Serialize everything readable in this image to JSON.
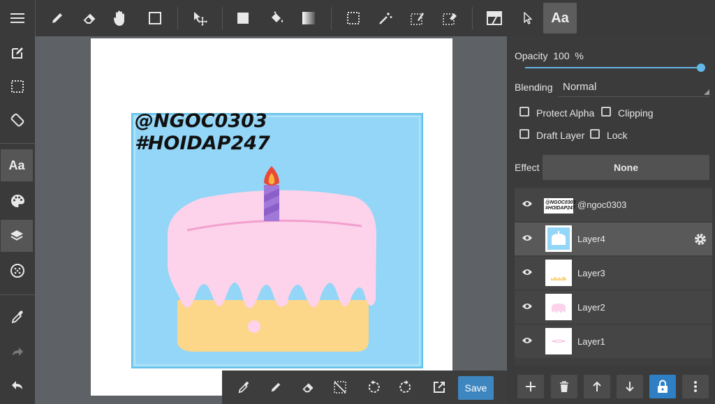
{
  "toolbar": {
    "text_tool_label": "Aa"
  },
  "sidebar": {
    "text_tool_label": "Aa"
  },
  "artwork": {
    "line1": "@NGOC0303",
    "line2": "#HOIDAP247"
  },
  "layer_props": {
    "opacity_label": "Opacity",
    "opacity_value": "100",
    "opacity_unit": "%",
    "opacity_level": 1.0,
    "blending_label": "Blending",
    "blending_value": "Normal",
    "protect_alpha": "Protect Alpha",
    "clipping": "Clipping",
    "draft_layer": "Draft Layer",
    "lock": "Lock",
    "effect_label": "Effect",
    "effect_value": "None"
  },
  "layers": [
    {
      "name": "@ngoc0303",
      "selected": false
    },
    {
      "name": "Layer4",
      "selected": true
    },
    {
      "name": "Layer3",
      "selected": false
    },
    {
      "name": "Layer2",
      "selected": false
    },
    {
      "name": "Layer1",
      "selected": false
    }
  ],
  "bottombar": {
    "save_label": "Save"
  },
  "colors": {
    "accent": "#62b8e8",
    "save_button": "#3e86c0",
    "lock_button": "#2f7fc4",
    "canvas_sky": "#93d6f7",
    "cake_frosting": "#fcd3ea",
    "cake_base": "#fcd689"
  }
}
